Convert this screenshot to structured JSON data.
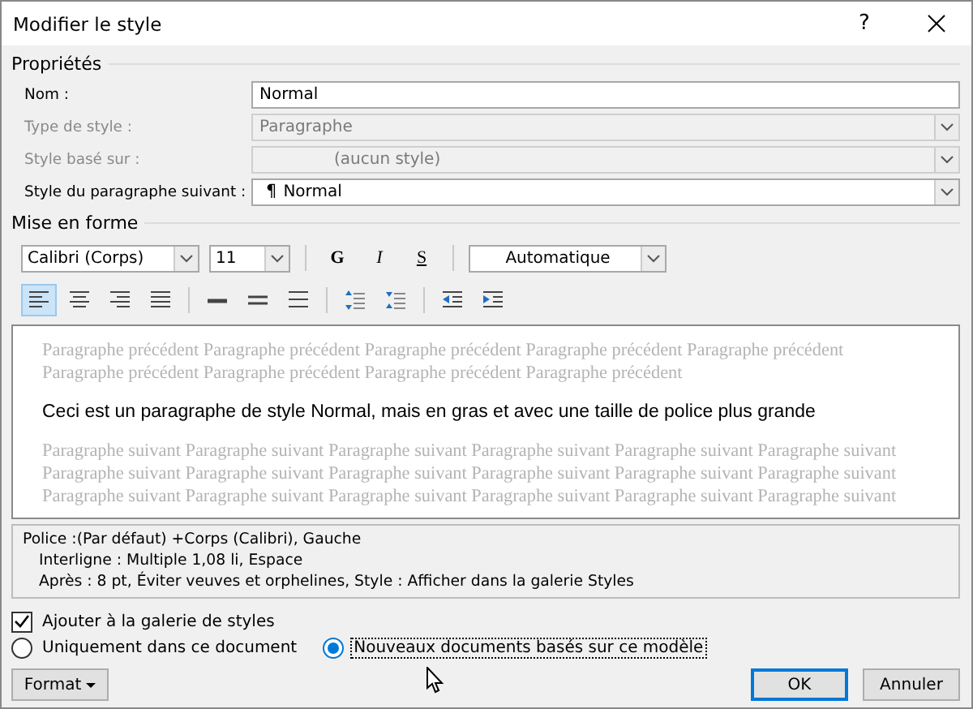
{
  "window": {
    "title": "Modifier le style",
    "help": "?"
  },
  "properties": {
    "heading": "Propriétés",
    "rows": [
      {
        "label": "Nom :",
        "kind": "text",
        "value": "Normal",
        "disabled": false
      },
      {
        "label": "Type de style :",
        "kind": "dropdown",
        "value": "Paragraphe",
        "disabled": true
      },
      {
        "label": "Style basé sur :",
        "kind": "dropdown",
        "value": "(aucun style)",
        "disabled": true,
        "indented": true
      },
      {
        "label": "Style du paragraphe suivant :",
        "kind": "dropdown",
        "symbol": "¶",
        "value": "Normal",
        "disabled": false
      }
    ]
  },
  "formatting": {
    "heading": "Mise en forme",
    "font": "Calibri (Corps)",
    "size": "11",
    "styles": [
      {
        "label": "G",
        "kind": "bold"
      },
      {
        "label": "I",
        "kind": "italic"
      },
      {
        "label": "S",
        "kind": "underline"
      }
    ],
    "color_setting": "Automatique",
    "paragraph_tools": [
      {
        "kind": "align-left",
        "selected": true
      },
      {
        "kind": "align-center",
        "selected": false
      },
      {
        "kind": "align-right",
        "selected": false
      },
      {
        "kind": "justify",
        "selected": false
      },
      {
        "kind": "separator"
      },
      {
        "kind": "spacing-single",
        "selected": false
      },
      {
        "kind": "spacing-half",
        "selected": false
      },
      {
        "kind": "spacing-double",
        "selected": false
      },
      {
        "kind": "separator"
      },
      {
        "kind": "space-more",
        "selected": false
      },
      {
        "kind": "space-less",
        "selected": false
      },
      {
        "kind": "separator"
      },
      {
        "kind": "indent-less",
        "selected": false
      },
      {
        "kind": "indent-more",
        "selected": false
      }
    ]
  },
  "preview": {
    "before": "Paragraphe précédent Paragraphe précédent Paragraphe précédent Paragraphe précédent Paragraphe précédent Paragraphe précédent Paragraphe précédent Paragraphe précédent Paragraphe précédent",
    "sample": "Ceci est un paragraphe de style Normal, mais en gras et avec une taille de police plus grande",
    "after": "Paragraphe suivant Paragraphe suivant Paragraphe suivant Paragraphe suivant Paragraphe suivant Paragraphe suivant Paragraphe suivant Paragraphe suivant Paragraphe suivant Paragraphe suivant Paragraphe suivant Paragraphe suivant Paragraphe suivant Paragraphe suivant Paragraphe suivant Paragraphe suivant Paragraphe suivant Paragraphe suivant"
  },
  "description": [
    "Police :(Par défaut) +Corps (Calibri), Gauche",
    "Interligne : Multiple 1,08 li, Espace",
    "Après : 8 pt, Éviter veuves et orphelines, Style : Afficher dans la galerie Styles"
  ],
  "add_to_gallery": {
    "label": "Ajouter à la galerie de styles",
    "checked": true
  },
  "scope": [
    {
      "label": "Uniquement dans ce document",
      "selected": false
    },
    {
      "label": "Nouveaux documents basés sur ce modèle",
      "selected": true
    }
  ],
  "buttons": {
    "format": "Format",
    "ok": "OK",
    "cancel": "Annuler"
  }
}
